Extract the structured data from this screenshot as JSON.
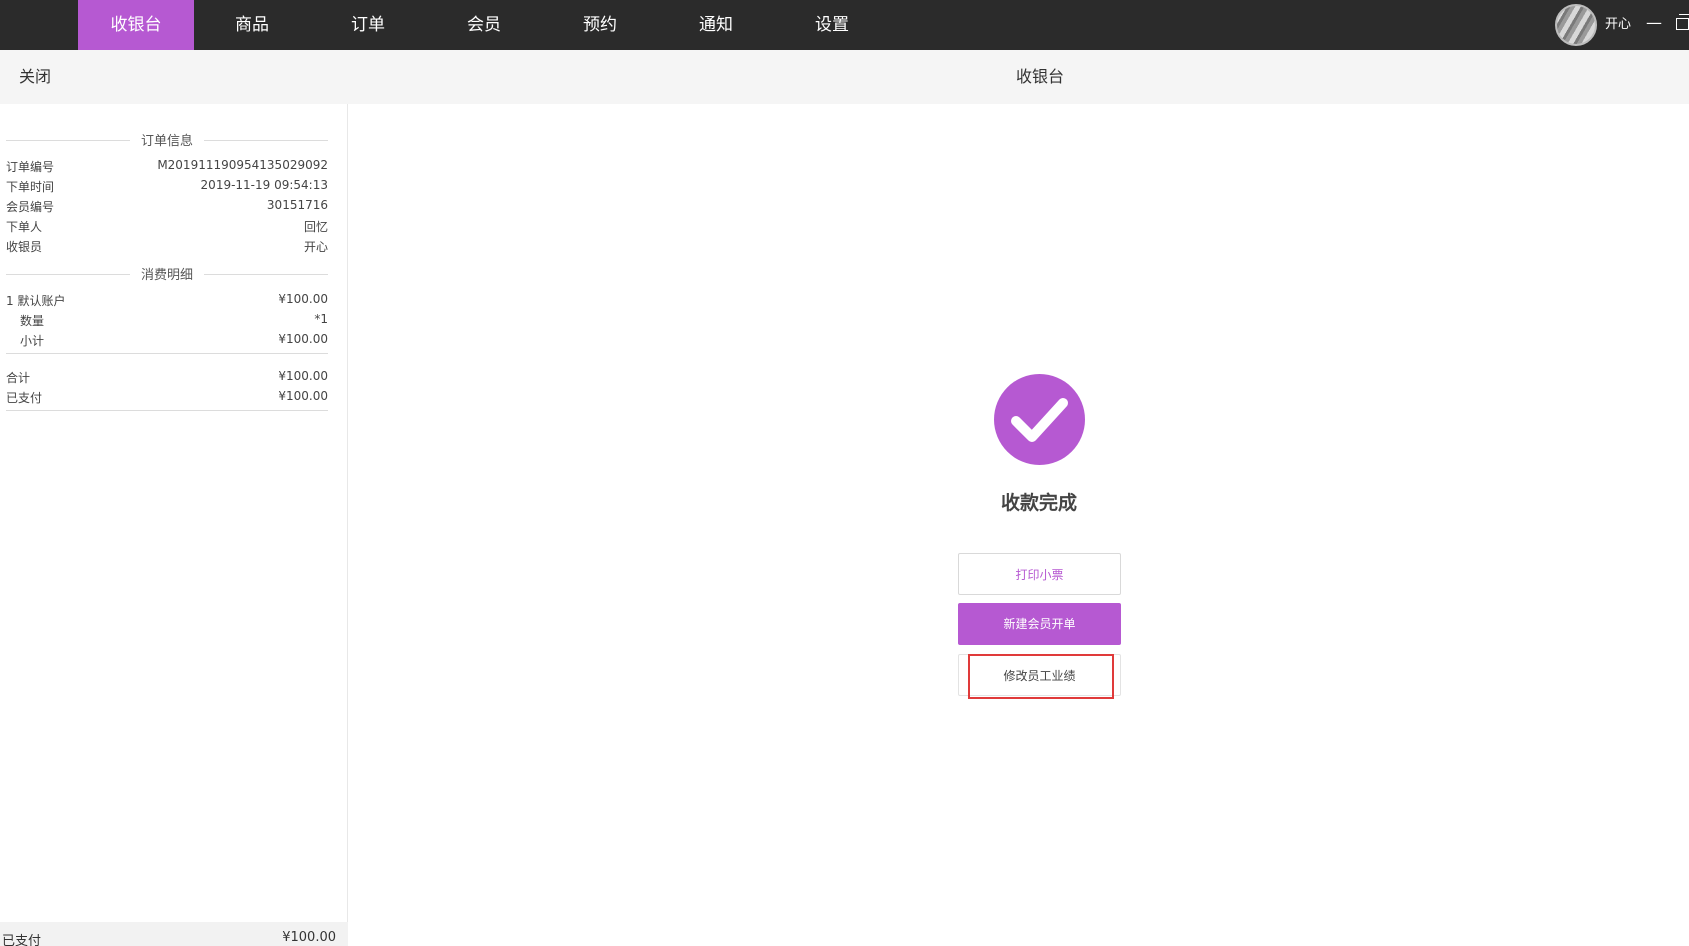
{
  "nav": {
    "items": [
      {
        "label": "收银台",
        "active": true
      },
      {
        "label": "商品",
        "active": false
      },
      {
        "label": "订单",
        "active": false
      },
      {
        "label": "会员",
        "active": false
      },
      {
        "label": "预约",
        "active": false
      },
      {
        "label": "通知",
        "active": false
      },
      {
        "label": "设置",
        "active": false
      }
    ],
    "user_name": "开心",
    "minimize_glyph": "—"
  },
  "subheader": {
    "close_label": "关闭",
    "title": "收银台"
  },
  "receipt": {
    "order_info_title": "订单信息",
    "order_info": [
      {
        "key": "订单编号",
        "value": "M201911190954135029092"
      },
      {
        "key": "下单时间",
        "value": "2019-11-19 09:54:13"
      },
      {
        "key": "会员编号",
        "value": "30151716"
      },
      {
        "key": "下单人",
        "value": "回忆"
      },
      {
        "key": "收银员",
        "value": "开心"
      }
    ],
    "detail_title": "消费明细",
    "detail": [
      {
        "key": "1  默认账户",
        "value": "¥100.00"
      },
      {
        "key": "数量",
        "value": "*1"
      },
      {
        "key": "小计",
        "value": "¥100.00"
      }
    ],
    "totals": [
      {
        "key": "合计",
        "value": "¥100.00"
      },
      {
        "key": "已支付",
        "value": "¥100.00"
      }
    ],
    "footer": {
      "key": "已支付",
      "value": "¥100.00"
    }
  },
  "main": {
    "success_text": "收款完成",
    "buttons": {
      "print": "打印小票",
      "new_order": "新建会员开单",
      "edit_performance": "修改员工业绩"
    }
  },
  "colors": {
    "accent": "#b659d2",
    "topbar": "#2b2b2b",
    "highlight": "#e03a3a"
  },
  "icons": {
    "success": "check-circle-icon",
    "avatar": "avatar",
    "minimize": "minimize-icon",
    "restore": "restore-window-icon"
  }
}
